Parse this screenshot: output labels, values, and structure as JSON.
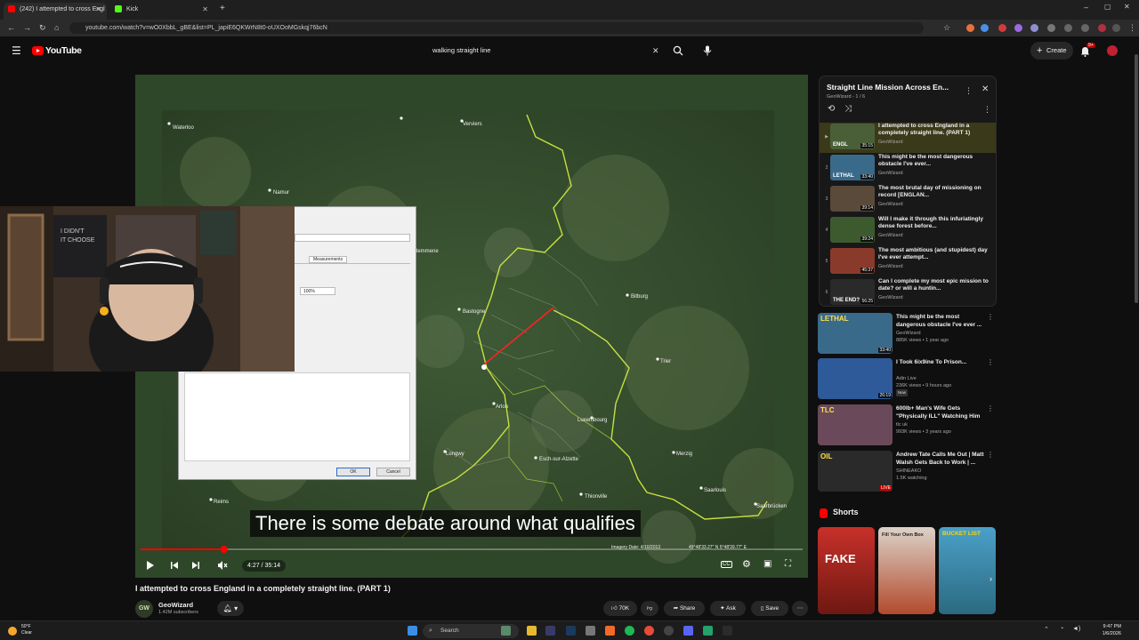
{
  "browser": {
    "tabs": [
      {
        "label": "(242) I attempted to cross Engl",
        "active": true,
        "color": "#ff0000"
      },
      {
        "label": "Kick",
        "active": false,
        "color": "#53fc18"
      }
    ],
    "url": "youtube.com/watch?v=wO0XbbL_gBE&list=PL_japiE6QKWrN8t0-oUXOoMGskqj76bcN"
  },
  "header": {
    "logo": "YouTube",
    "search_value": "walking straight line",
    "create_label": "Create",
    "notif_count": "9+"
  },
  "player": {
    "caption": "There is some debate around what qualifies",
    "time": "4:27 / 35:14",
    "progress_fraction": 0.126,
    "map_footer": "Imagery Date: 4/10/2013",
    "map_coords": "49°48'33.27\" N    5°48'39.77\" E",
    "map_labels": [
      "Waterloo",
      "Namur",
      "Verviers",
      "Bastogne",
      "Bitburg",
      "Arlon",
      "Luxembourg",
      "Trier",
      "Esch-sur-Alzette",
      "Merzig",
      "Thionville",
      "Saarlouis",
      "Longwy",
      "Saarbrücken",
      "Reims",
      "Hemmene"
    ],
    "dialog": {
      "tab": "Measurements",
      "zoom": "100%",
      "ok": "OK",
      "cancel": "Cancel"
    }
  },
  "video": {
    "title": "I attempted to cross England in a completely straight line. (PART 1)",
    "channel": "GeoWizard",
    "channel_initials": "GW",
    "subs": "1.42M subscribers",
    "likes": "70K",
    "share": "Share",
    "ask": "Ask",
    "save": "Save"
  },
  "playlist": {
    "title": "Straight Line Mission Across En...",
    "sub": "GeoWizard - 1 / 6",
    "items": [
      {
        "num": "▶",
        "title": "I attempted to cross England in a completely straight line. (PART 1)",
        "channel": "GeoWizard",
        "duration": "35:15",
        "thumb_text": "ENGL"
      },
      {
        "num": "2",
        "title": "This might be the most dangerous obstacle I've ever...",
        "channel": "GeoWizard",
        "duration": "33:40",
        "thumb_text": "LETHAL"
      },
      {
        "num": "3",
        "title": "The most brutal day of missioning on record [ENGLAN...",
        "channel": "GeoWizard",
        "duration": "39:14",
        "thumb_text": ""
      },
      {
        "num": "4",
        "title": "Will I make it through this infuriatingly dense forest before...",
        "channel": "GeoWizard",
        "duration": "39:24",
        "thumb_text": ""
      },
      {
        "num": "5",
        "title": "The most ambitious (and stupidest) day I've ever attempt...",
        "channel": "GeoWizard",
        "duration": "45:37",
        "thumb_text": ""
      },
      {
        "num": "6",
        "title": "Can I complete my most epic mission to date? or will a huntin...",
        "channel": "GeoWizard",
        "duration": "56:25",
        "thumb_text": "THE END?"
      }
    ]
  },
  "recommendations": [
    {
      "title": "This might be the most dangerous obstacle I've ever ...",
      "channel": "GeoWizard",
      "meta": "885K views • 1 year ago",
      "badge": "",
      "duration": "33:40",
      "thumb_text": "LETHAL"
    },
    {
      "title": "I Took 6ix9ine To Prison...",
      "channel": "Adin Live",
      "meta": "236K views • 9 hours ago",
      "badge": "New",
      "duration": "26:19",
      "thumb_text": ""
    },
    {
      "title": "600lb+ Man's Wife Gets \"Physically ILL\" Watching Him ...",
      "channel": "tlc uk",
      "meta": "993K views • 3 years ago",
      "badge": "",
      "duration": "",
      "thumb_text": "TLC"
    },
    {
      "title": "Andrew Tate Calls Me Out | Matt Walsh Gets Back to Work | ...",
      "channel": "SHINEAKO",
      "meta": "1.5K watching",
      "badge": "",
      "duration": "LIVE",
      "thumb_text": "OIL"
    }
  ],
  "shorts": {
    "heading": "Shorts",
    "items": [
      {
        "text": "FAKE"
      },
      {
        "text": "Fill Your Own Box"
      },
      {
        "text": "BUCKET LIST"
      }
    ]
  },
  "taskbar": {
    "search": "Search",
    "weather_temp": "50°F",
    "weather_desc": "Clear",
    "time": "9:47 PM",
    "date": "1/6/2026"
  }
}
